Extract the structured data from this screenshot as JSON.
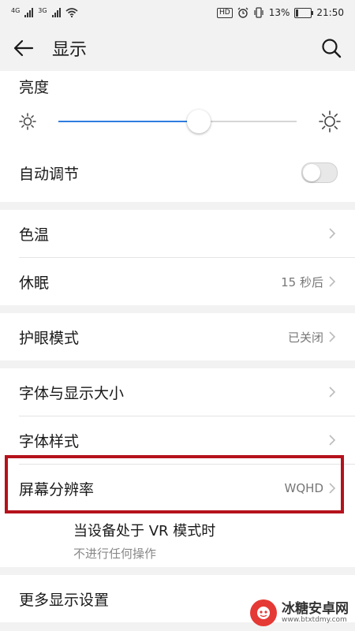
{
  "status_bar": {
    "sim1": "4G",
    "sim2": "3G",
    "hd": "HD",
    "battery": "13%",
    "time": "21:50"
  },
  "appbar": {
    "title": "显示"
  },
  "brightness": {
    "label": "亮度",
    "level": 0.59
  },
  "auto_adjust": {
    "label": "自动调节",
    "enabled": false
  },
  "color_temp": {
    "label": "色温"
  },
  "sleep": {
    "label": "休眠",
    "value": "15 秒后"
  },
  "eye_mode": {
    "label": "护眼模式",
    "value": "已关闭"
  },
  "font_size": {
    "label": "字体与显示大小"
  },
  "font_style": {
    "label": "字体样式"
  },
  "resolution": {
    "label": "屏幕分辨率",
    "value": "WQHD"
  },
  "vr": {
    "title": "当设备处于 VR 模式时",
    "subtitle": "不进行任何操作"
  },
  "more": {
    "label": "更多显示设置"
  },
  "watermark": {
    "text": "冰糖安卓网",
    "url": "www.btxtdmy.com"
  },
  "colors": {
    "accent": "#2f7de1",
    "highlight": "#b5121b"
  }
}
